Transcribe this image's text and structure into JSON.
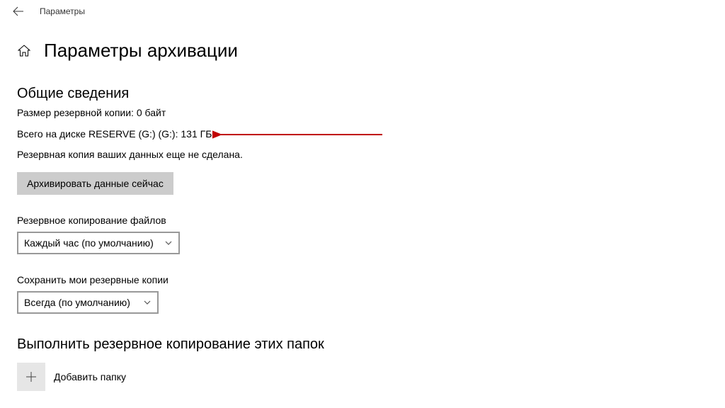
{
  "titlebar": {
    "title": "Параметры"
  },
  "page": {
    "title": "Параметры архивации"
  },
  "overview": {
    "heading": "Общие сведения",
    "backup_size": "Размер резервной копии: 0 байт",
    "disk_total": "Всего на диске RESERVE (G:) (G:): 131 ГБ",
    "not_backed_up": "Резервная копия ваших данных еще не сделана.",
    "backup_now_button": "Архивировать данные сейчас"
  },
  "frequency": {
    "label": "Резервное копирование файлов",
    "selected": "Каждый час (по умолчанию)"
  },
  "retention": {
    "label": "Сохранить мои резервные копии",
    "selected": "Всегда (по умолчанию)"
  },
  "folders": {
    "heading": "Выполнить резервное копирование этих папок",
    "add_label": "Добавить папку"
  }
}
